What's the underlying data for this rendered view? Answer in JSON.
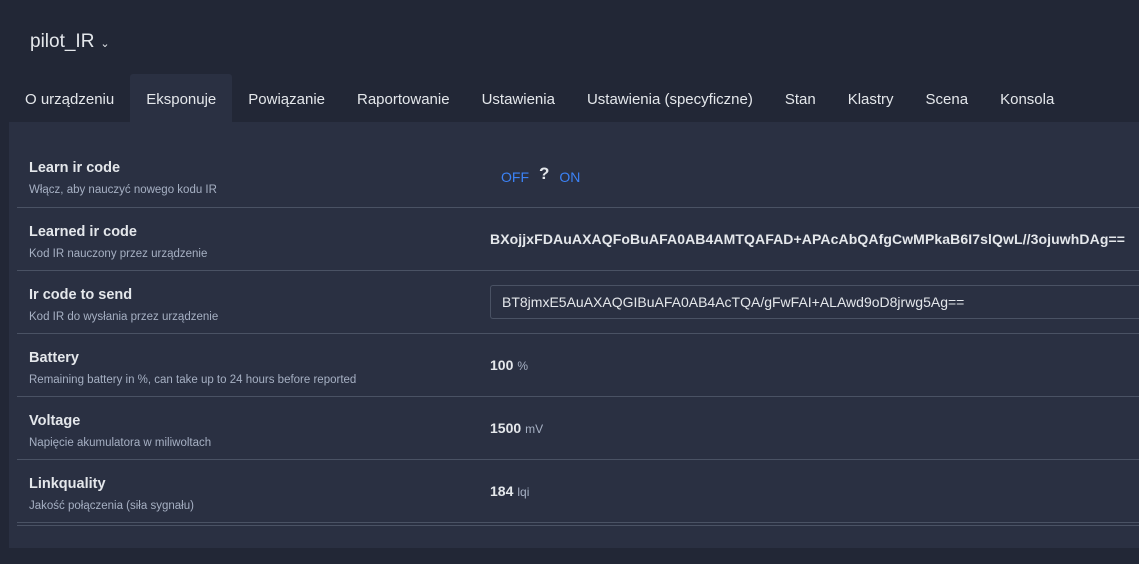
{
  "device": {
    "name": "pilot_IR"
  },
  "tabs": [
    {
      "label": "O urządzeniu"
    },
    {
      "label": "Eksponuje"
    },
    {
      "label": "Powiązanie"
    },
    {
      "label": "Raportowanie"
    },
    {
      "label": "Ustawienia"
    },
    {
      "label": "Ustawienia (specyficzne)"
    },
    {
      "label": "Stan"
    },
    {
      "label": "Klastry"
    },
    {
      "label": "Scena"
    },
    {
      "label": "Konsola"
    }
  ],
  "active_tab": "Eksponuje",
  "rows": {
    "learn": {
      "label": "Learn ir code",
      "desc": "Włącz, aby nauczyć nowego kodu IR",
      "off": "OFF",
      "unknown": "?",
      "on": "ON"
    },
    "learned": {
      "label": "Learned ir code",
      "desc": "Kod IR nauczony przez urządzenie",
      "value": "BXojjxFDAuAXAQFoBuAFA0AB4AMTQAFAD+APAcAbQAfgCwMPkaB6I7slQwL//3ojuwhDAg=="
    },
    "send": {
      "label": "Ir code to send",
      "desc": "Kod IR do wysłania przez urządzenie",
      "value": "BT8jmxE5AuAXAQGIBuAFA0AB4AcTQA/gFwFAI+ALAwd9oD8jrwg5Ag=="
    },
    "battery": {
      "label": "Battery",
      "desc": "Remaining battery in %, can take up to 24 hours before reported",
      "value": "100",
      "unit": "%"
    },
    "voltage": {
      "label": "Voltage",
      "desc": "Napięcie akumulatora w miliwoltach",
      "value": "1500",
      "unit": "mV"
    },
    "linkquality": {
      "label": "Linkquality",
      "desc": "Jakość połączenia (siła sygnału)",
      "value": "184",
      "unit": "lqi"
    }
  },
  "colors": {
    "background": "#222736",
    "panel": "#2a3042",
    "accent": "#3b82f6",
    "border": "#4a5264"
  }
}
